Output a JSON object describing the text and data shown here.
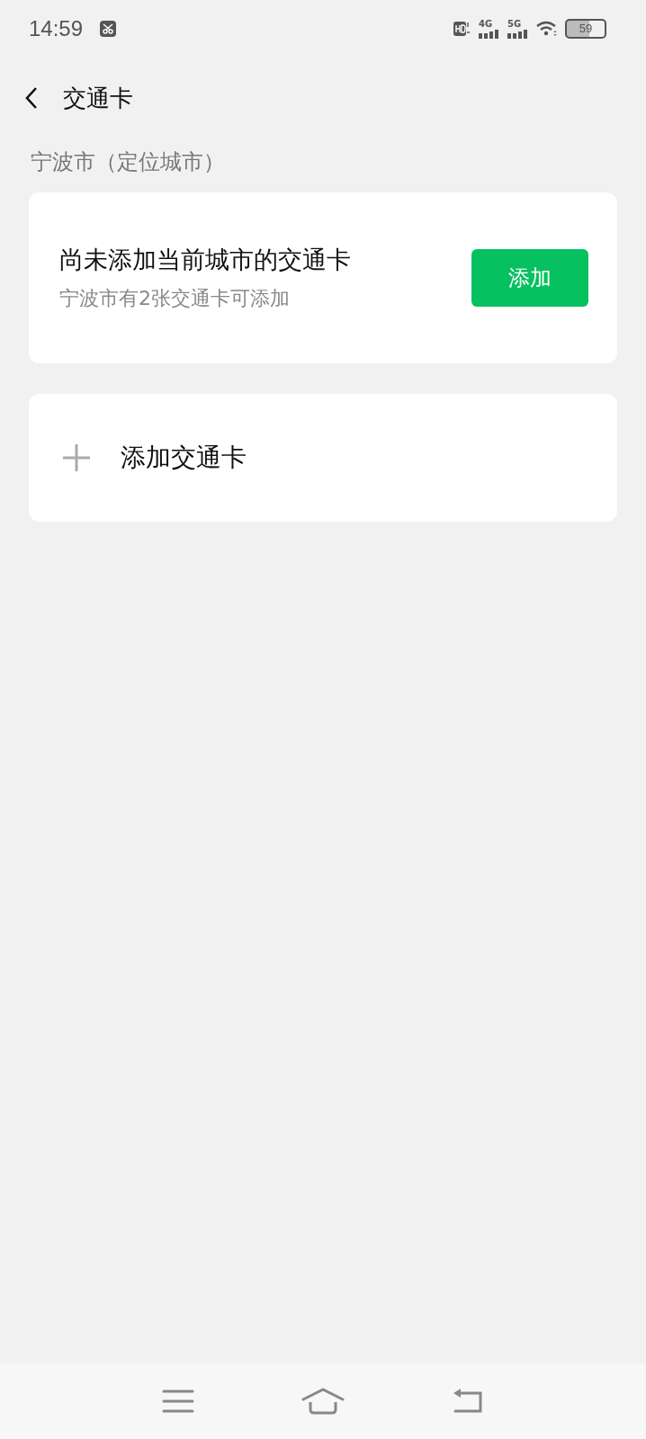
{
  "status_bar": {
    "time": "14:59",
    "network_1": "4G",
    "network_2": "5G",
    "battery": "59"
  },
  "header": {
    "title": "交通卡"
  },
  "section": {
    "label": "宁波市（定位城市）"
  },
  "prompt_card": {
    "title": "尚未添加当前城市的交通卡",
    "subtitle": "宁波市有2张交通卡可添加",
    "button": "添加"
  },
  "add_card": {
    "label": "添加交通卡"
  }
}
